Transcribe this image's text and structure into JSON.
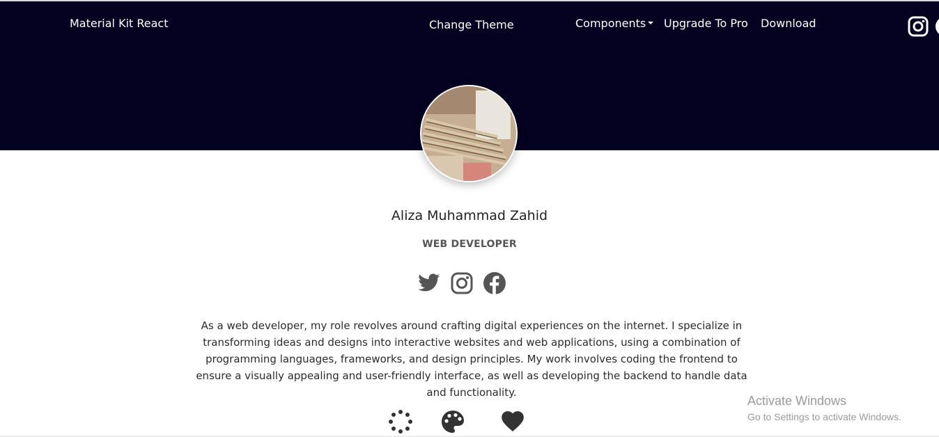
{
  "nav": {
    "brand": "Material Kit React",
    "change_theme": "Change Theme",
    "components": "Components",
    "upgrade": "Upgrade To Pro",
    "download": "Download",
    "icons": [
      "instagram-icon"
    ]
  },
  "profile": {
    "name": "Aliza Muhammad Zahid",
    "title": "WEB DEVELOPER",
    "social_icons": [
      "twitter-icon",
      "instagram-icon",
      "facebook-icon"
    ],
    "bio": "As a web developer, my role revolves around crafting digital experiences on the internet. I specialize in transforming ideas and designs into interactive websites and web applications, using a combination of programming languages, frameworks, and design principles. My work involves coding the frontend to ensure a visually appealing and user-friendly interface, as well as developing the backend to handle data and functionality."
  },
  "bottom_icons": [
    "loading-spinner-icon",
    "palette-icon",
    "heart-icon"
  ],
  "watermark": {
    "line1": "Activate Windows",
    "line2": "Go to Settings to activate Windows."
  },
  "colors": {
    "hero_background": "#050121",
    "text": "#2b2b2b",
    "icon": "#555555"
  }
}
